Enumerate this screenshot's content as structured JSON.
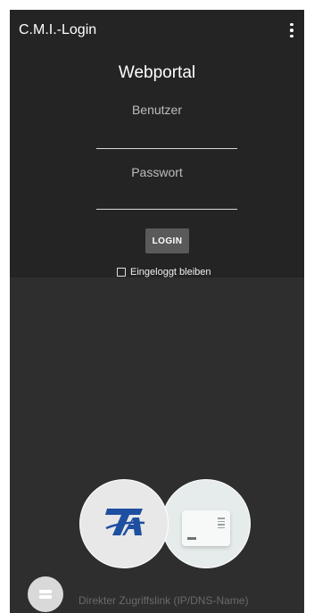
{
  "appbar": {
    "title": "C.M.I.-Login",
    "menu_icon": "more-vert-icon"
  },
  "login": {
    "title": "Webportal",
    "user_label": "Benutzer",
    "password_label": "Passwort",
    "login_button": "LOGIN",
    "stay_logged_in_label": "Eingeloggt bleiben",
    "stay_logged_in_checked": false
  },
  "bottom": {
    "direct_link_placeholder": "Direkter Zugriffslink (IP/DNS-Name)",
    "fab_icon": "plug-icon"
  },
  "colors": {
    "background": "#2e2e2e",
    "panel": "#242424",
    "brand_blue": "#1f4fa0"
  }
}
